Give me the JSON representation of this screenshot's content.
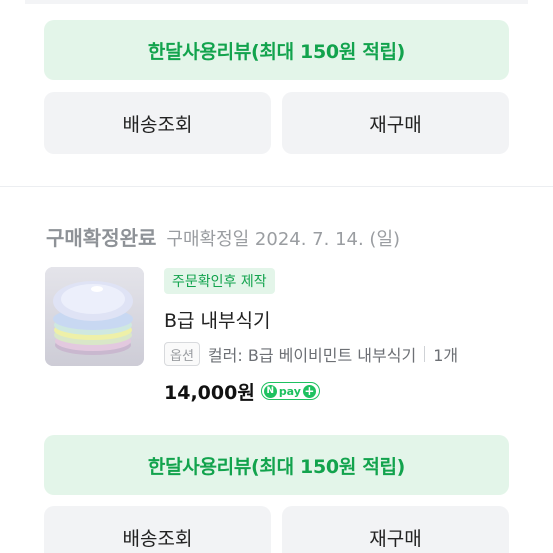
{
  "orders": [
    {
      "review_label": "한달사용리뷰(최대 150원 적립)",
      "delivery_label": "배송조회",
      "rebuy_label": "재구매"
    },
    {
      "status": "구매확정완료",
      "status_date": "구매확정일 2024. 7. 14. (일)",
      "tag": "주문확인후 제작",
      "product_name": "B급 내부식기",
      "option_chip": "옵션",
      "option_text": "컬러: B급 베이비민트 내부식기",
      "quantity": "1개",
      "price": "14,000원",
      "pay_badge": "pay",
      "review_label": "한달사용리뷰(최대 150원 적립)",
      "delivery_label": "배송조회",
      "rebuy_label": "재구매"
    }
  ],
  "colors": {
    "accent_green": "#12a34d",
    "review_bg": "#e3f5e9",
    "button_bg": "#f2f3f5"
  }
}
